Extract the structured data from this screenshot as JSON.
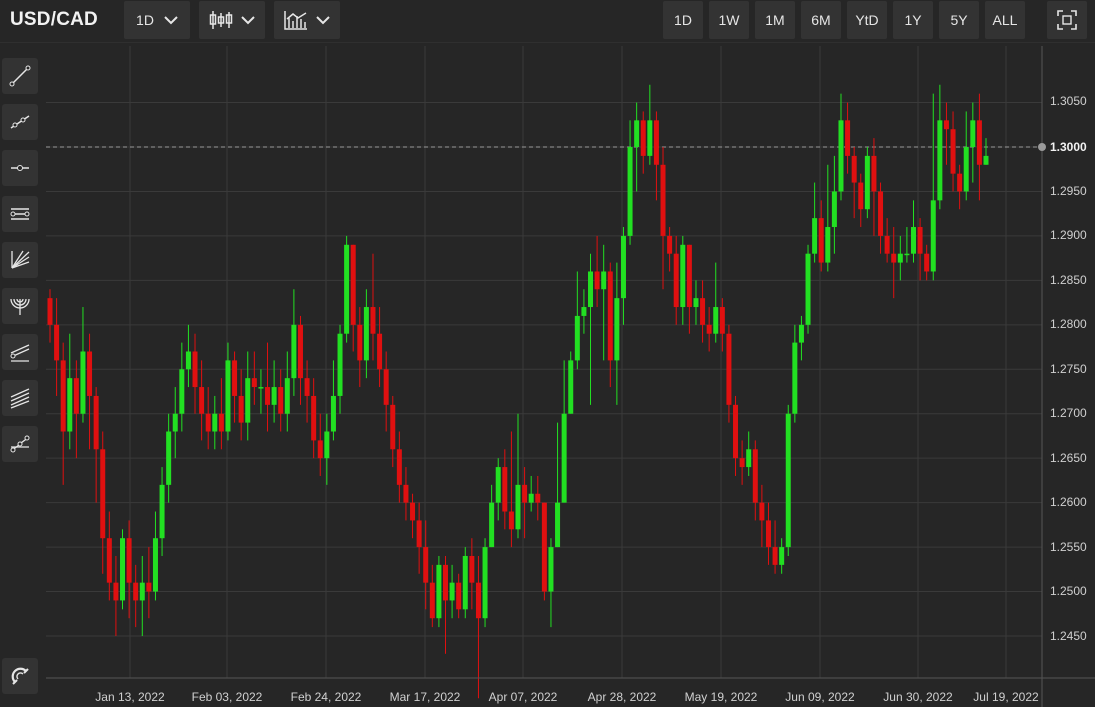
{
  "header": {
    "symbol": "USD/CAD",
    "interval": "1D",
    "range_buttons": [
      "1D",
      "1W",
      "1M",
      "6M",
      "YtD",
      "1Y",
      "5Y",
      "ALL"
    ]
  },
  "sidebar": {
    "tools": [
      "trend-line-icon",
      "ray-line-icon",
      "horizontal-line-icon",
      "parallel-channel-icon",
      "fan-lines-icon",
      "fibonacci-arc-icon",
      "regression-channel-icon",
      "pitchfork-icon",
      "polyline-icon"
    ],
    "bottom_tool": "magnet-icon"
  },
  "colors": {
    "up": "#22e022",
    "down": "#e01010",
    "background": "#262626",
    "grid": "#3a3a3a"
  },
  "chart_data": {
    "type": "candlestick",
    "symbol": "USD/CAD",
    "price_axis_labels": [
      "1.3050",
      "1.2950",
      "1.2900",
      "1.2850",
      "1.2800",
      "1.2750",
      "1.2700",
      "1.2650",
      "1.2600",
      "1.2550",
      "1.2500",
      "1.2450"
    ],
    "date_axis_labels": [
      "Jan 13, 2022",
      "Feb 03, 2022",
      "Feb 24, 2022",
      "Mar 17, 2022",
      "Apr 07, 2022",
      "Apr 28, 2022",
      "May 19, 2022",
      "Jun 09, 2022",
      "Jun 30, 2022",
      "Jul 19, 2022"
    ],
    "current_price": "1.3000",
    "ylim": [
      1.24,
      1.31
    ],
    "candles": [
      [
        1.283,
        1.28,
        1.284,
        1.278
      ],
      [
        1.28,
        1.276,
        1.283,
        1.272
      ],
      [
        1.276,
        1.268,
        1.278,
        1.262
      ],
      [
        1.268,
        1.274,
        1.279,
        1.266
      ],
      [
        1.274,
        1.27,
        1.276,
        1.265
      ],
      [
        1.27,
        1.277,
        1.282,
        1.269
      ],
      [
        1.277,
        1.272,
        1.279,
        1.266
      ],
      [
        1.272,
        1.266,
        1.273,
        1.26
      ],
      [
        1.266,
        1.256,
        1.268,
        1.252
      ],
      [
        1.256,
        1.251,
        1.259,
        1.249
      ],
      [
        1.251,
        1.249,
        1.254,
        1.245
      ],
      [
        1.249,
        1.256,
        1.257,
        1.248
      ],
      [
        1.256,
        1.251,
        1.258,
        1.247
      ],
      [
        1.251,
        1.249,
        1.253,
        1.246
      ],
      [
        1.249,
        1.251,
        1.254,
        1.245
      ],
      [
        1.251,
        1.25,
        1.255,
        1.247
      ],
      [
        1.25,
        1.256,
        1.259,
        1.249
      ],
      [
        1.256,
        1.262,
        1.264,
        1.254
      ],
      [
        1.262,
        1.268,
        1.27,
        1.26
      ],
      [
        1.268,
        1.27,
        1.273,
        1.265
      ],
      [
        1.27,
        1.275,
        1.278,
        1.268
      ],
      [
        1.275,
        1.277,
        1.28,
        1.273
      ],
      [
        1.277,
        1.273,
        1.279,
        1.27
      ],
      [
        1.273,
        1.27,
        1.276,
        1.267
      ],
      [
        1.27,
        1.268,
        1.273,
        1.266
      ],
      [
        1.268,
        1.27,
        1.272,
        1.266
      ],
      [
        1.27,
        1.268,
        1.274,
        1.266
      ],
      [
        1.268,
        1.276,
        1.278,
        1.267
      ],
      [
        1.276,
        1.272,
        1.277,
        1.269
      ],
      [
        1.272,
        1.269,
        1.275,
        1.267
      ],
      [
        1.269,
        1.274,
        1.277,
        1.267
      ],
      [
        1.274,
        1.273,
        1.277,
        1.271
      ],
      [
        1.273,
        1.273,
        1.275,
        1.27
      ],
      [
        1.273,
        1.271,
        1.278,
        1.268
      ],
      [
        1.271,
        1.273,
        1.276,
        1.269
      ],
      [
        1.273,
        1.27,
        1.275,
        1.268
      ],
      [
        1.27,
        1.274,
        1.277,
        1.268
      ],
      [
        1.274,
        1.28,
        1.284,
        1.272
      ],
      [
        1.28,
        1.274,
        1.281,
        1.271
      ],
      [
        1.274,
        1.272,
        1.276,
        1.269
      ],
      [
        1.272,
        1.267,
        1.274,
        1.265
      ],
      [
        1.267,
        1.265,
        1.27,
        1.263
      ],
      [
        1.265,
        1.268,
        1.27,
        1.262
      ],
      [
        1.268,
        1.272,
        1.276,
        1.267
      ],
      [
        1.272,
        1.279,
        1.28,
        1.27
      ],
      [
        1.279,
        1.289,
        1.29,
        1.278
      ],
      [
        1.289,
        1.28,
        1.289,
        1.277
      ],
      [
        1.28,
        1.276,
        1.282,
        1.273
      ],
      [
        1.276,
        1.282,
        1.284,
        1.274
      ],
      [
        1.282,
        1.279,
        1.288,
        1.276
      ],
      [
        1.279,
        1.275,
        1.282,
        1.273
      ],
      [
        1.275,
        1.271,
        1.277,
        1.268
      ],
      [
        1.271,
        1.266,
        1.272,
        1.264
      ],
      [
        1.266,
        1.262,
        1.268,
        1.26
      ],
      [
        1.262,
        1.26,
        1.264,
        1.258
      ],
      [
        1.26,
        1.258,
        1.261,
        1.256
      ],
      [
        1.258,
        1.255,
        1.26,
        1.252
      ],
      [
        1.255,
        1.251,
        1.258,
        1.248
      ],
      [
        1.251,
        1.247,
        1.253,
        1.246
      ],
      [
        1.247,
        1.253,
        1.254,
        1.246
      ],
      [
        1.253,
        1.249,
        1.254,
        1.243
      ],
      [
        1.249,
        1.251,
        1.253,
        1.247
      ],
      [
        1.251,
        1.248,
        1.252,
        1.247
      ],
      [
        1.248,
        1.254,
        1.255,
        1.247
      ],
      [
        1.254,
        1.251,
        1.256,
        1.248
      ],
      [
        1.251,
        1.247,
        1.254,
        1.238
      ],
      [
        1.247,
        1.255,
        1.256,
        1.246
      ],
      [
        1.255,
        1.26,
        1.262,
        1.255
      ],
      [
        1.26,
        1.264,
        1.265,
        1.258
      ],
      [
        1.264,
        1.259,
        1.266,
        1.257
      ],
      [
        1.259,
        1.257,
        1.268,
        1.255
      ],
      [
        1.257,
        1.262,
        1.27,
        1.256
      ],
      [
        1.262,
        1.26,
        1.264,
        1.256
      ],
      [
        1.26,
        1.261,
        1.263,
        1.259
      ],
      [
        1.261,
        1.26,
        1.263,
        1.258
      ],
      [
        1.26,
        1.25,
        1.26,
        1.249
      ],
      [
        1.25,
        1.255,
        1.256,
        1.246
      ],
      [
        1.255,
        1.26,
        1.269,
        1.255
      ],
      [
        1.26,
        1.27,
        1.276,
        1.26
      ],
      [
        1.27,
        1.276,
        1.277,
        1.27
      ],
      [
        1.276,
        1.281,
        1.286,
        1.275
      ],
      [
        1.281,
        1.282,
        1.284,
        1.279
      ],
      [
        1.282,
        1.286,
        1.288,
        1.271
      ],
      [
        1.286,
        1.284,
        1.29,
        1.282
      ],
      [
        1.284,
        1.286,
        1.289,
        1.276
      ],
      [
        1.286,
        1.276,
        1.287,
        1.273
      ],
      [
        1.276,
        1.283,
        1.287,
        1.271
      ],
      [
        1.283,
        1.29,
        1.291,
        1.28
      ],
      [
        1.29,
        1.3,
        1.303,
        1.289
      ],
      [
        1.3,
        1.303,
        1.305,
        1.295
      ],
      [
        1.303,
        1.299,
        1.304,
        1.297
      ],
      [
        1.299,
        1.303,
        1.307,
        1.298
      ],
      [
        1.303,
        1.298,
        1.304,
        1.294
      ],
      [
        1.298,
        1.29,
        1.3,
        1.284
      ],
      [
        1.29,
        1.288,
        1.291,
        1.286
      ],
      [
        1.288,
        1.282,
        1.29,
        1.28
      ],
      [
        1.282,
        1.289,
        1.29,
        1.28
      ],
      [
        1.289,
        1.282,
        1.289,
        1.279
      ],
      [
        1.282,
        1.283,
        1.285,
        1.28
      ],
      [
        1.283,
        1.28,
        1.285,
        1.278
      ],
      [
        1.28,
        1.279,
        1.282,
        1.277
      ],
      [
        1.279,
        1.282,
        1.287,
        1.278
      ],
      [
        1.282,
        1.279,
        1.283,
        1.277
      ],
      [
        1.279,
        1.271,
        1.28,
        1.269
      ],
      [
        1.271,
        1.265,
        1.272,
        1.263
      ],
      [
        1.265,
        1.264,
        1.267,
        1.262
      ],
      [
        1.264,
        1.266,
        1.268,
        1.263
      ],
      [
        1.266,
        1.26,
        1.267,
        1.258
      ],
      [
        1.26,
        1.258,
        1.262,
        1.255
      ],
      [
        1.258,
        1.255,
        1.26,
        1.253
      ],
      [
        1.255,
        1.253,
        1.258,
        1.252
      ],
      [
        1.253,
        1.255,
        1.256,
        1.252
      ],
      [
        1.255,
        1.27,
        1.271,
        1.254
      ],
      [
        1.27,
        1.278,
        1.28,
        1.269
      ],
      [
        1.278,
        1.28,
        1.281,
        1.276
      ],
      [
        1.28,
        1.288,
        1.289,
        1.279
      ],
      [
        1.288,
        1.292,
        1.296,
        1.287
      ],
      [
        1.292,
        1.287,
        1.294,
        1.286
      ],
      [
        1.287,
        1.291,
        1.298,
        1.286
      ],
      [
        1.291,
        1.295,
        1.299,
        1.288
      ],
      [
        1.295,
        1.303,
        1.306,
        1.294
      ],
      [
        1.303,
        1.299,
        1.305,
        1.297
      ],
      [
        1.299,
        1.296,
        1.3,
        1.292
      ],
      [
        1.296,
        1.293,
        1.297,
        1.291
      ],
      [
        1.293,
        1.299,
        1.3,
        1.292
      ],
      [
        1.299,
        1.295,
        1.301,
        1.29
      ],
      [
        1.295,
        1.29,
        1.296,
        1.288
      ],
      [
        1.29,
        1.288,
        1.292,
        1.287
      ],
      [
        1.288,
        1.287,
        1.291,
        1.283
      ],
      [
        1.287,
        1.288,
        1.29,
        1.285
      ],
      [
        1.288,
        1.288,
        1.291,
        1.287
      ],
      [
        1.288,
        1.291,
        1.294,
        1.287
      ],
      [
        1.291,
        1.288,
        1.292,
        1.285
      ],
      [
        1.288,
        1.286,
        1.289,
        1.285
      ],
      [
        1.286,
        1.294,
        1.306,
        1.285
      ],
      [
        1.294,
        1.303,
        1.307,
        1.293
      ],
      [
        1.303,
        1.302,
        1.305,
        1.298
      ],
      [
        1.302,
        1.297,
        1.304,
        1.295
      ],
      [
        1.297,
        1.295,
        1.298,
        1.293
      ],
      [
        1.295,
        1.3,
        1.304,
        1.294
      ],
      [
        1.3,
        1.303,
        1.305,
        1.296
      ],
      [
        1.303,
        1.298,
        1.306,
        1.294
      ],
      [
        1.298,
        1.299,
        1.301,
        1.298
      ]
    ]
  }
}
